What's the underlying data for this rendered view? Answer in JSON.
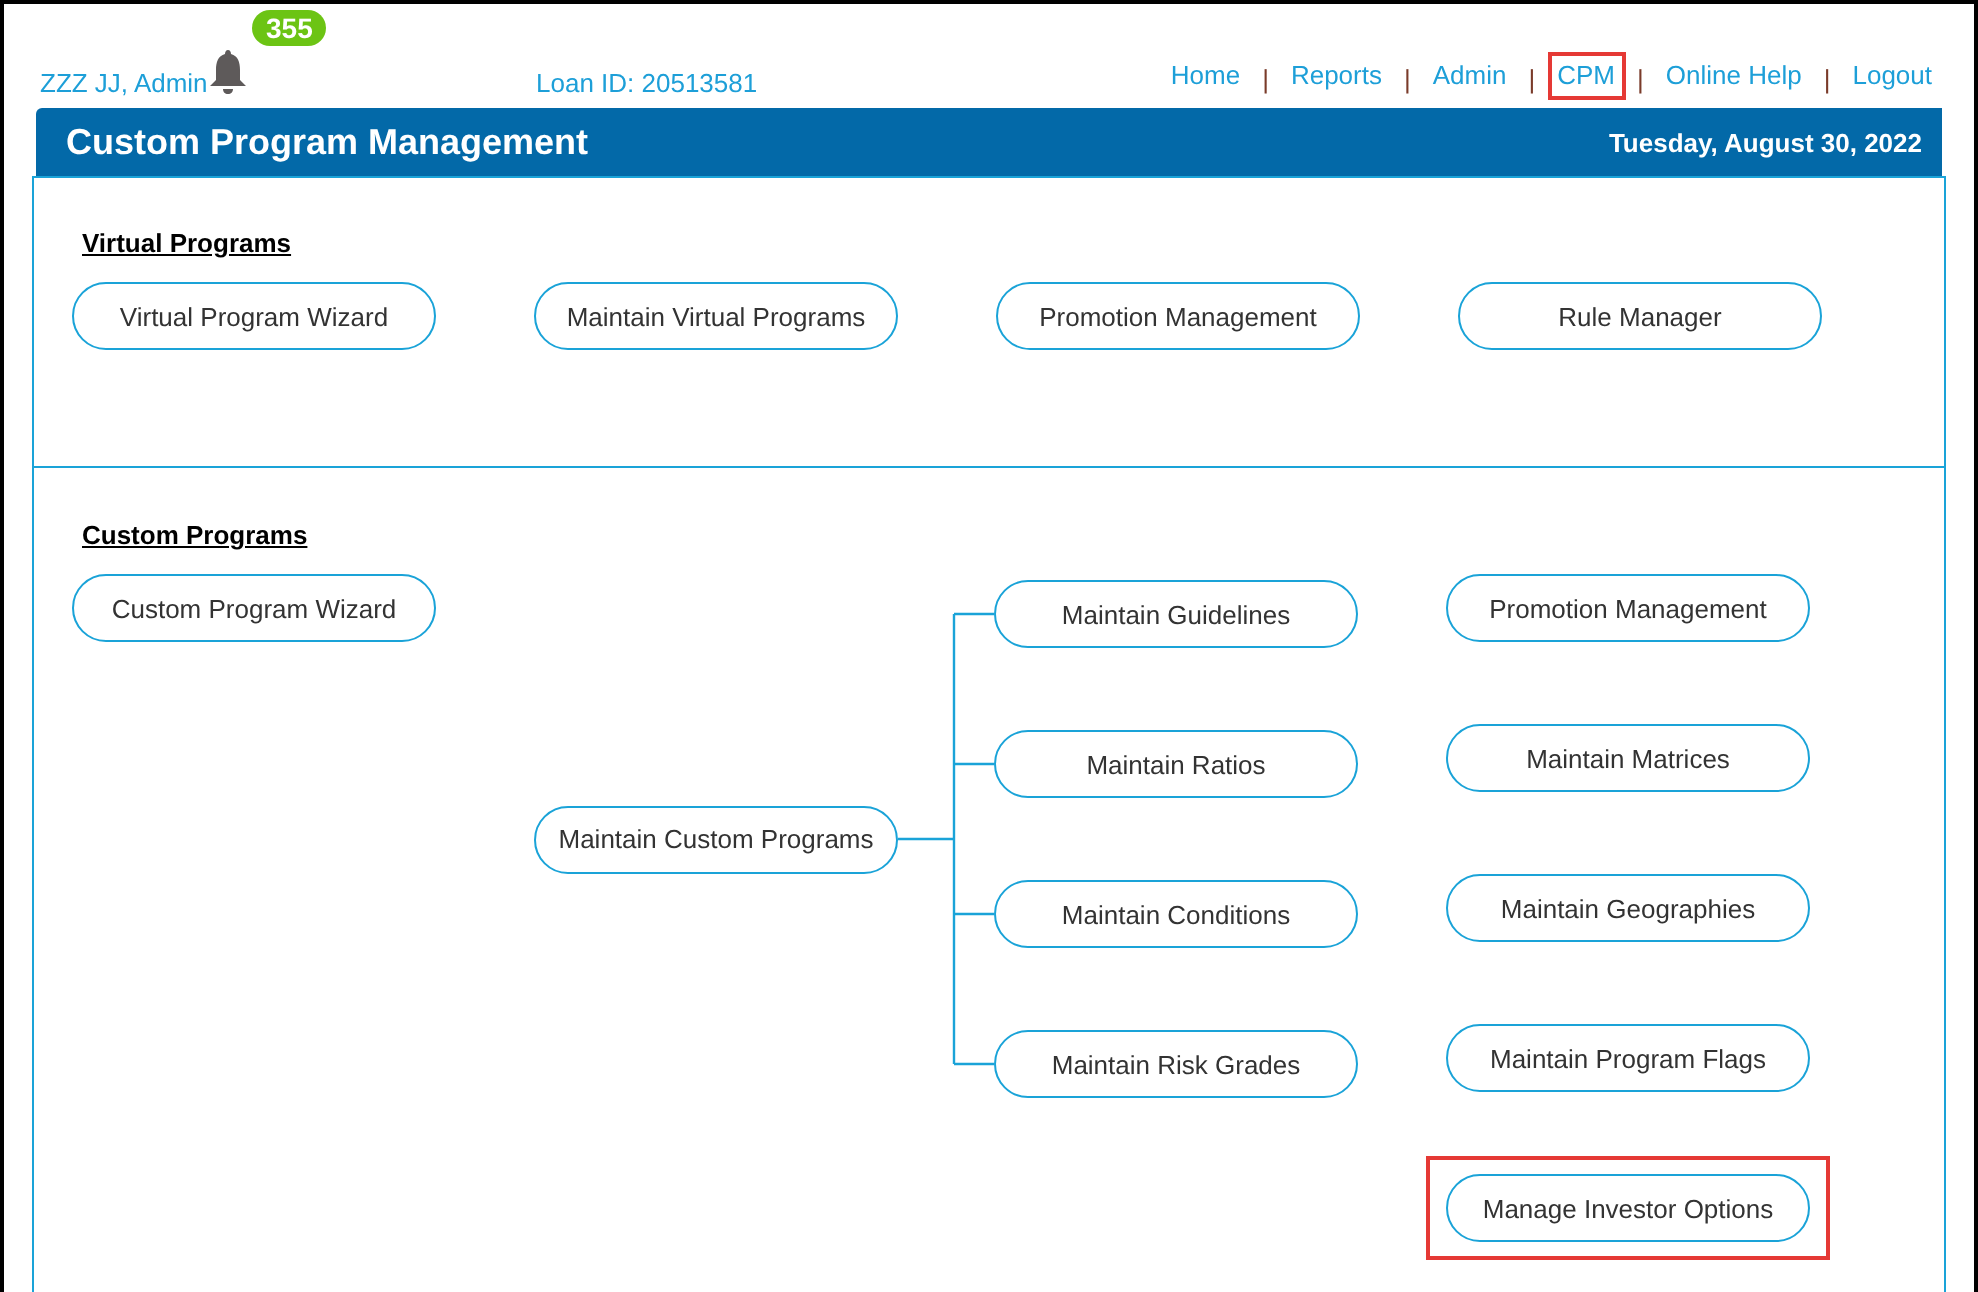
{
  "header": {
    "user": "ZZZ JJ, Admin",
    "notification_count": "355",
    "loan_id": "Loan ID: 20513581",
    "nav": [
      {
        "kind": "link",
        "label": "Home",
        "highlighted": false
      },
      {
        "kind": "separator",
        "label": "|"
      },
      {
        "kind": "link",
        "label": "Reports",
        "highlighted": false
      },
      {
        "kind": "separator",
        "label": "|"
      },
      {
        "kind": "link",
        "label": "Admin",
        "highlighted": false
      },
      {
        "kind": "separator",
        "label": "|"
      },
      {
        "kind": "link",
        "label": "CPM",
        "highlighted": true
      },
      {
        "kind": "separator",
        "label": "|"
      },
      {
        "kind": "link",
        "label": "Online Help",
        "highlighted": false
      },
      {
        "kind": "separator",
        "label": "|"
      },
      {
        "kind": "link",
        "label": "Logout",
        "highlighted": false
      }
    ]
  },
  "title_bar": {
    "title": "Custom Program Management",
    "date": "Tuesday, August 30, 2022"
  },
  "virtual_programs": {
    "heading": "Virtual Programs",
    "buttons": [
      {
        "label": "Virtual Program Wizard",
        "highlighted": false
      },
      {
        "label": "Maintain Virtual Programs",
        "highlighted": false
      },
      {
        "label": "Promotion Management",
        "highlighted": false
      },
      {
        "label": "Rule Manager",
        "highlighted": false
      }
    ]
  },
  "custom_programs": {
    "heading": "Custom Programs",
    "wizard": {
      "label": "Custom Program Wizard",
      "highlighted": false
    },
    "parent": {
      "label": "Maintain Custom Programs",
      "highlighted": false
    },
    "children": [
      {
        "label": "Maintain Guidelines",
        "highlighted": false
      },
      {
        "label": "Maintain Ratios",
        "highlighted": false
      },
      {
        "label": "Maintain Conditions",
        "highlighted": false
      },
      {
        "label": "Maintain Risk Grades",
        "highlighted": false
      }
    ],
    "other": [
      {
        "label": "Promotion Management",
        "highlighted": false
      },
      {
        "label": "Maintain Matrices",
        "highlighted": false
      },
      {
        "label": "Maintain Geographies",
        "highlighted": false
      },
      {
        "label": "Maintain Program Flags",
        "highlighted": false
      },
      {
        "label": "Manage Investor Options",
        "highlighted": true
      }
    ]
  }
}
